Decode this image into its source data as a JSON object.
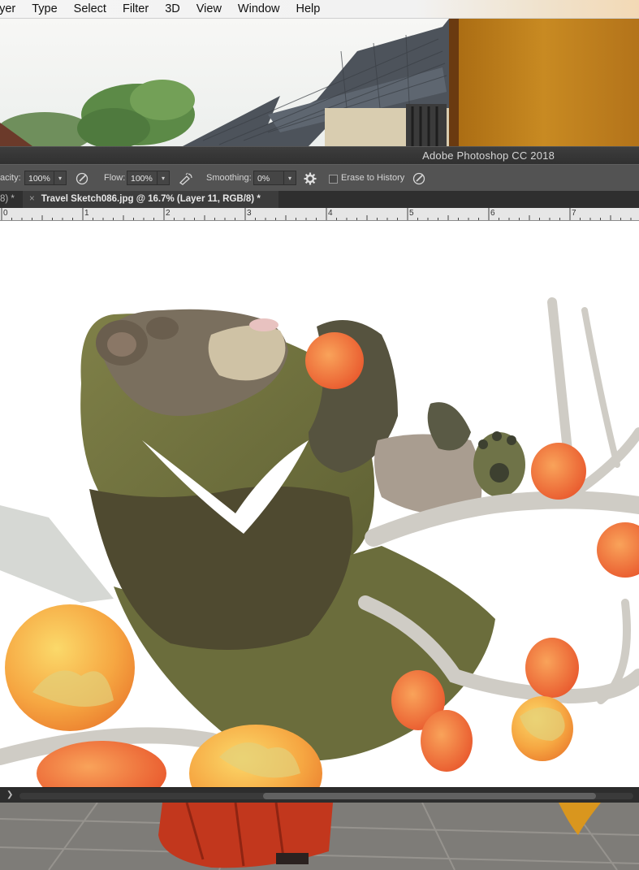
{
  "menu": {
    "items": [
      {
        "label": "ayer"
      },
      {
        "label": "Type"
      },
      {
        "label": "Select"
      },
      {
        "label": "Filter"
      },
      {
        "label": "3D"
      },
      {
        "label": "View"
      },
      {
        "label": "Window"
      },
      {
        "label": "Help"
      }
    ]
  },
  "app": {
    "title": "Adobe Photoshop CC 2018"
  },
  "options": {
    "opacity_label": "acity:",
    "opacity_value": "100%",
    "flow_label": "Flow:",
    "flow_value": "100%",
    "smoothing_label": "Smoothing:",
    "smoothing_value": "0%",
    "erase_to_history_label": "Erase to History",
    "erase_to_history_checked": false
  },
  "tabs": {
    "partial_label": "8) *",
    "close_glyph": "×",
    "active_label": "Travel Sketch086.jpg @ 16.7% (Layer 11, RGB/8) *"
  },
  "ruler": {
    "marks": [
      "0",
      "1",
      "2",
      "3",
      "4",
      "5",
      "6",
      "7"
    ]
  },
  "scrollbar": {
    "arrow_glyph": "❯"
  },
  "icons": {
    "brush_pressure": "brush-pressure-icon",
    "airbrush": "airbrush-icon",
    "settings": "gear-icon",
    "history_pressure": "brush-pressure-icon"
  },
  "colors": {
    "ui_dark": "#535353",
    "titlebar": "#353535",
    "tab_active": "#3c3c3c",
    "persimmon": "#f07a3a",
    "bear_fur": "#6e6e3a"
  }
}
